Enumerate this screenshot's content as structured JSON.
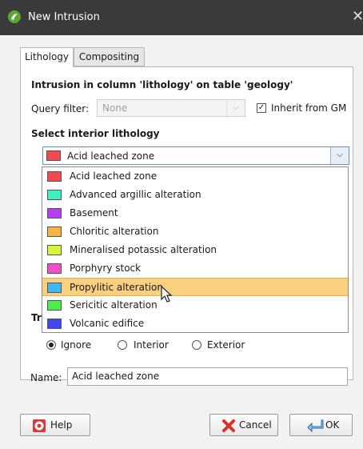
{
  "window": {
    "title": "New Intrusion",
    "close_glyph": "✕"
  },
  "tabs": [
    {
      "label": "Lithology",
      "active": true
    },
    {
      "label": "Compositing",
      "active": false
    }
  ],
  "panel": {
    "heading": "Intrusion in column 'lithology' on table 'geology'",
    "query_filter_label": "Query filter:",
    "query_filter_value": "None",
    "inherit_label": "Inherit from GM",
    "inherit_checked": true,
    "select_heading": "Select interior lithology",
    "selected_value": "Acid leached zone",
    "selected_color": "#f2484e",
    "truncated_label": "Tr",
    "radios": [
      {
        "label": "Ignore",
        "checked": true
      },
      {
        "label": "Interior",
        "checked": false
      },
      {
        "label": "Exterior",
        "checked": false
      }
    ],
    "name_label": "Name:",
    "name_value": "Acid leached zone"
  },
  "dropdown": {
    "items": [
      {
        "label": "Acid leached zone",
        "color": "#f2484e"
      },
      {
        "label": "Advanced argillic alteration",
        "color": "#3ff0c0"
      },
      {
        "label": "Basement",
        "color": "#b63ef0"
      },
      {
        "label": "Chloritic alteration",
        "color": "#f7b642"
      },
      {
        "label": "Mineralised potassic alteration",
        "color": "#d8f53a"
      },
      {
        "label": "Porphyry stock",
        "color": "#f24fc8"
      },
      {
        "label": "Propylitic alteration",
        "color": "#3fb7f5"
      },
      {
        "label": "Sericitic alteration",
        "color": "#49f04a"
      },
      {
        "label": "Volcanic edifice",
        "color": "#3f46f2"
      }
    ],
    "highlighted_index": 6
  },
  "buttons": {
    "help": "Help",
    "cancel": "Cancel",
    "ok": "OK"
  },
  "colors": {
    "titlebar": "#3a3a3a",
    "highlight": "#f8d080"
  }
}
